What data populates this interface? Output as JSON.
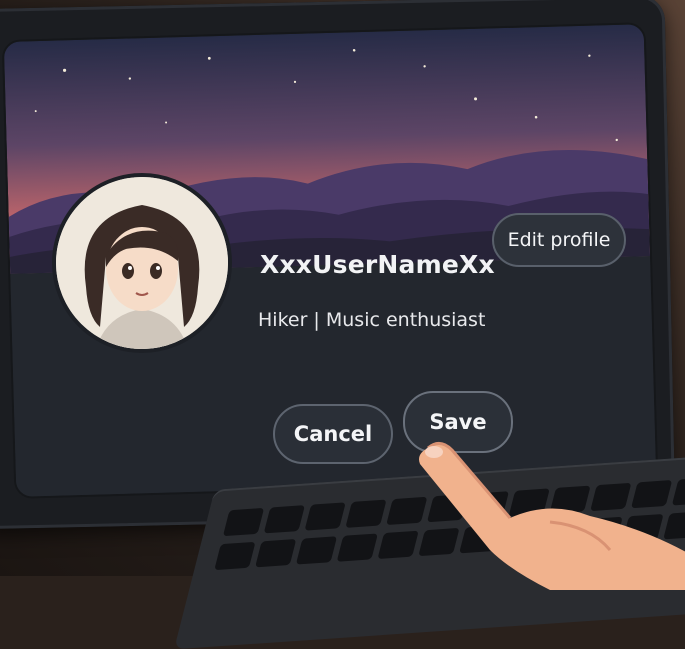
{
  "profile": {
    "username": "XxxUserNameXx",
    "bio": "Hiker | Music enthusiast",
    "edit_label": "Edit profile"
  },
  "actions": {
    "cancel_label": "Cancel",
    "save_label": "Save"
  },
  "colors": {
    "banner_sky_top": "#2b2f4a",
    "banner_sky_glow": "#d9795f",
    "mountains": "#4b3b66",
    "panel_bg": "#23272e",
    "button_border": "#5d646f"
  },
  "icons": {
    "avatar": "anime-girl-avatar"
  }
}
